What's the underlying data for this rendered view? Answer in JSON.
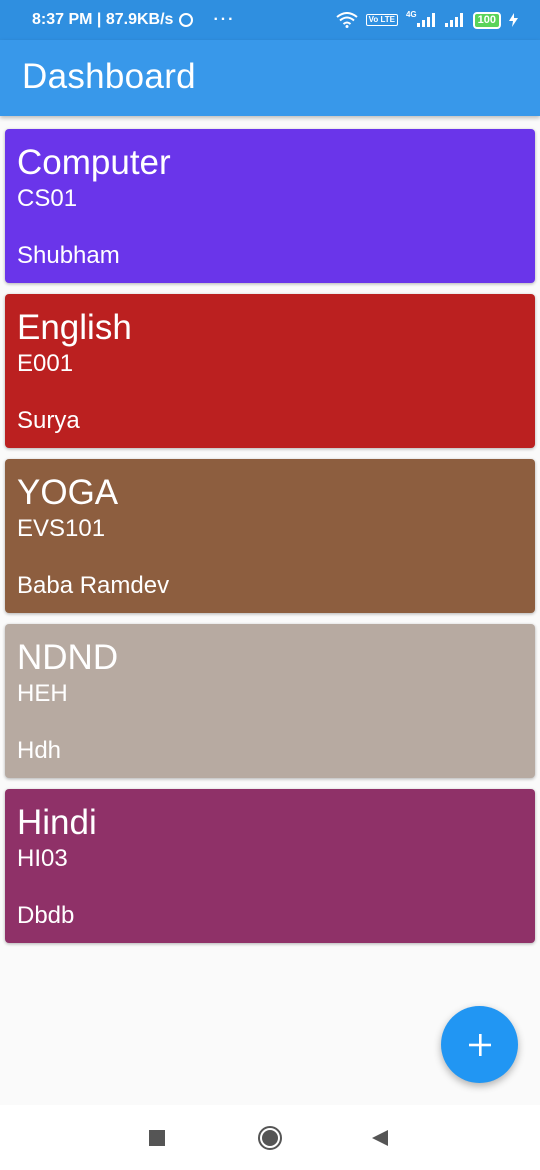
{
  "status_bar": {
    "time_speed": "8:37 PM | 87.9KB/s",
    "more": "···",
    "volte": "Vo LTE",
    "network": "4G",
    "battery": "100"
  },
  "app_bar": {
    "title": "Dashboard"
  },
  "colors": {
    "status_bar": "#2f8fe0",
    "app_bar": "#3898ea",
    "fab": "#2196f3"
  },
  "courses": [
    {
      "title": "Computer",
      "code": "CS01",
      "teacher": "Shubham",
      "color": "#6a35ea"
    },
    {
      "title": "English",
      "code": "E001",
      "teacher": "Surya",
      "color": "#bb2020"
    },
    {
      "title": "YOGA",
      "code": "EVS101",
      "teacher": "Baba Ramdev",
      "color": "#8d5e3f"
    },
    {
      "title": "NDND",
      "code": "HEH",
      "teacher": "Hdh",
      "color": "#b7aaa1"
    },
    {
      "title": "Hindi",
      "code": "HI03",
      "teacher": "Dbdb",
      "color": "#8f3168"
    }
  ],
  "fab": {
    "icon": "plus-icon"
  },
  "nav_bar": {
    "icons": [
      "recents-square-icon",
      "home-circle-icon",
      "back-triangle-icon"
    ]
  }
}
